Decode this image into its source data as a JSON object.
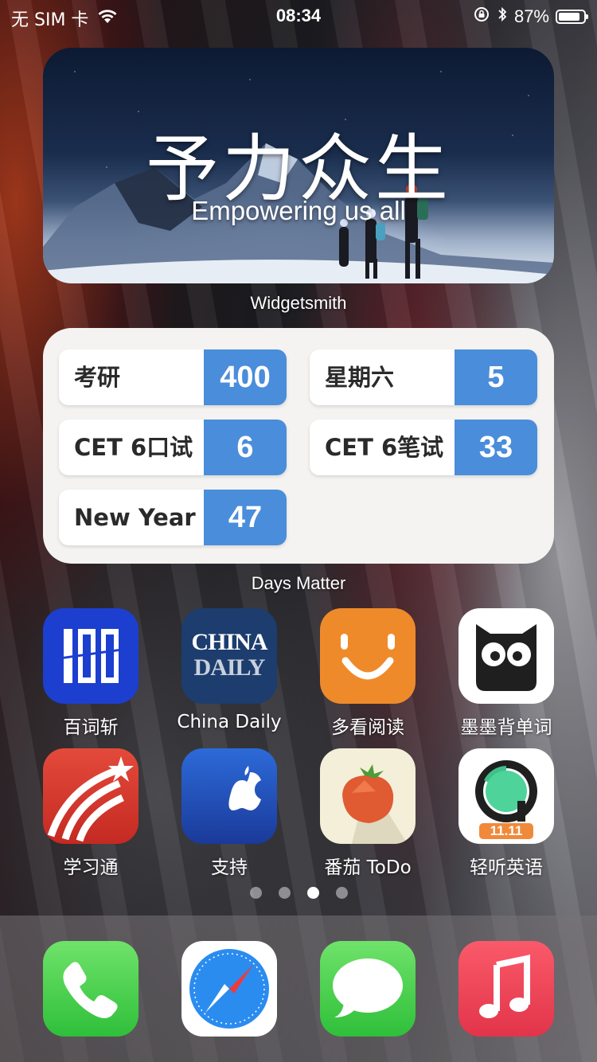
{
  "status_bar": {
    "carrier": "无 SIM 卡",
    "time": "08:34",
    "battery_percent": "87%",
    "battery_level": 0.87
  },
  "widgetsmith": {
    "title": "予力众生",
    "subtitle": "Empowering us all",
    "label": "Widgetsmith"
  },
  "days_matter": {
    "label": "Days Matter",
    "items": [
      {
        "name": "考研",
        "days": "400"
      },
      {
        "name": "星期六",
        "days": "5"
      },
      {
        "name": "CET 6口试",
        "days": "6"
      },
      {
        "name": "CET 6笔试",
        "days": "33"
      },
      {
        "name": "New Year",
        "days": "47"
      }
    ]
  },
  "apps": [
    {
      "name": "百词斩",
      "icon": "baicizhan-icon"
    },
    {
      "name": "China Daily",
      "icon": "china-daily-icon"
    },
    {
      "name": "多看阅读",
      "icon": "duokan-icon"
    },
    {
      "name": "墨墨背单词",
      "icon": "momo-owl-icon"
    },
    {
      "name": "学习通",
      "icon": "xuexitong-icon"
    },
    {
      "name": "支持",
      "icon": "apple-support-icon"
    },
    {
      "name": "番茄 ToDo",
      "icon": "tomato-icon"
    },
    {
      "name": "轻听英语",
      "icon": "qingting-icon"
    }
  ],
  "china_daily_icon_text": [
    "CHINA",
    "DAILY"
  ],
  "qingting_badge": "11.11",
  "page_indicator": {
    "count": 4,
    "active_index": 2
  },
  "dock": [
    {
      "icon": "phone-icon"
    },
    {
      "icon": "safari-icon"
    },
    {
      "icon": "messages-icon"
    },
    {
      "icon": "music-icon"
    }
  ]
}
